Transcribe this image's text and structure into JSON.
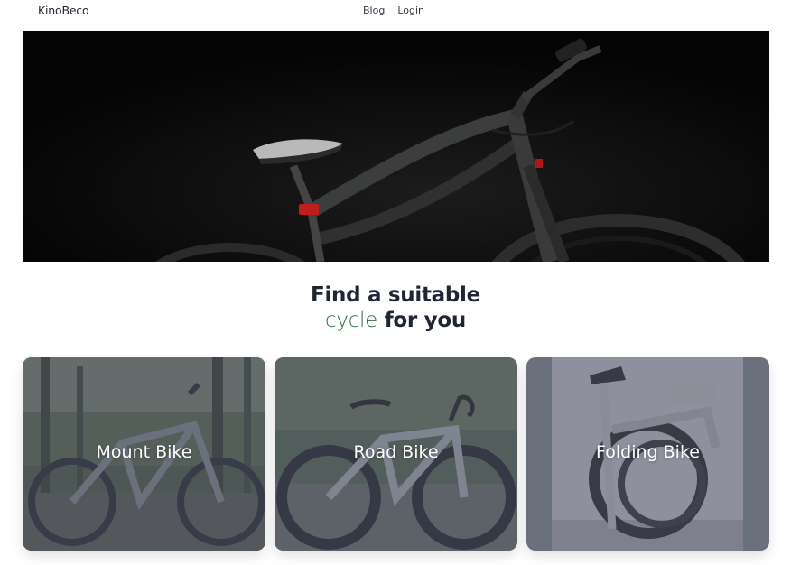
{
  "nav": {
    "brand": "KinoBeco",
    "links": [
      "Blog",
      "Login"
    ]
  },
  "hero": {
    "image": "black-bicycle-photo"
  },
  "section": {
    "title_line1": "Find a suitable",
    "title_accent": "cycle",
    "title_line2_rest": " for you"
  },
  "categories": [
    {
      "label": "Mount Bike",
      "image": "mountain-bike-forest-photo"
    },
    {
      "label": "Road Bike",
      "image": "road-bike-path-photo"
    },
    {
      "label": "Folding Bike",
      "image": "folding-bike-photo"
    }
  ],
  "colors": {
    "text": "#1f2532",
    "accent": "#2f6b45",
    "overlay": "#505668"
  }
}
